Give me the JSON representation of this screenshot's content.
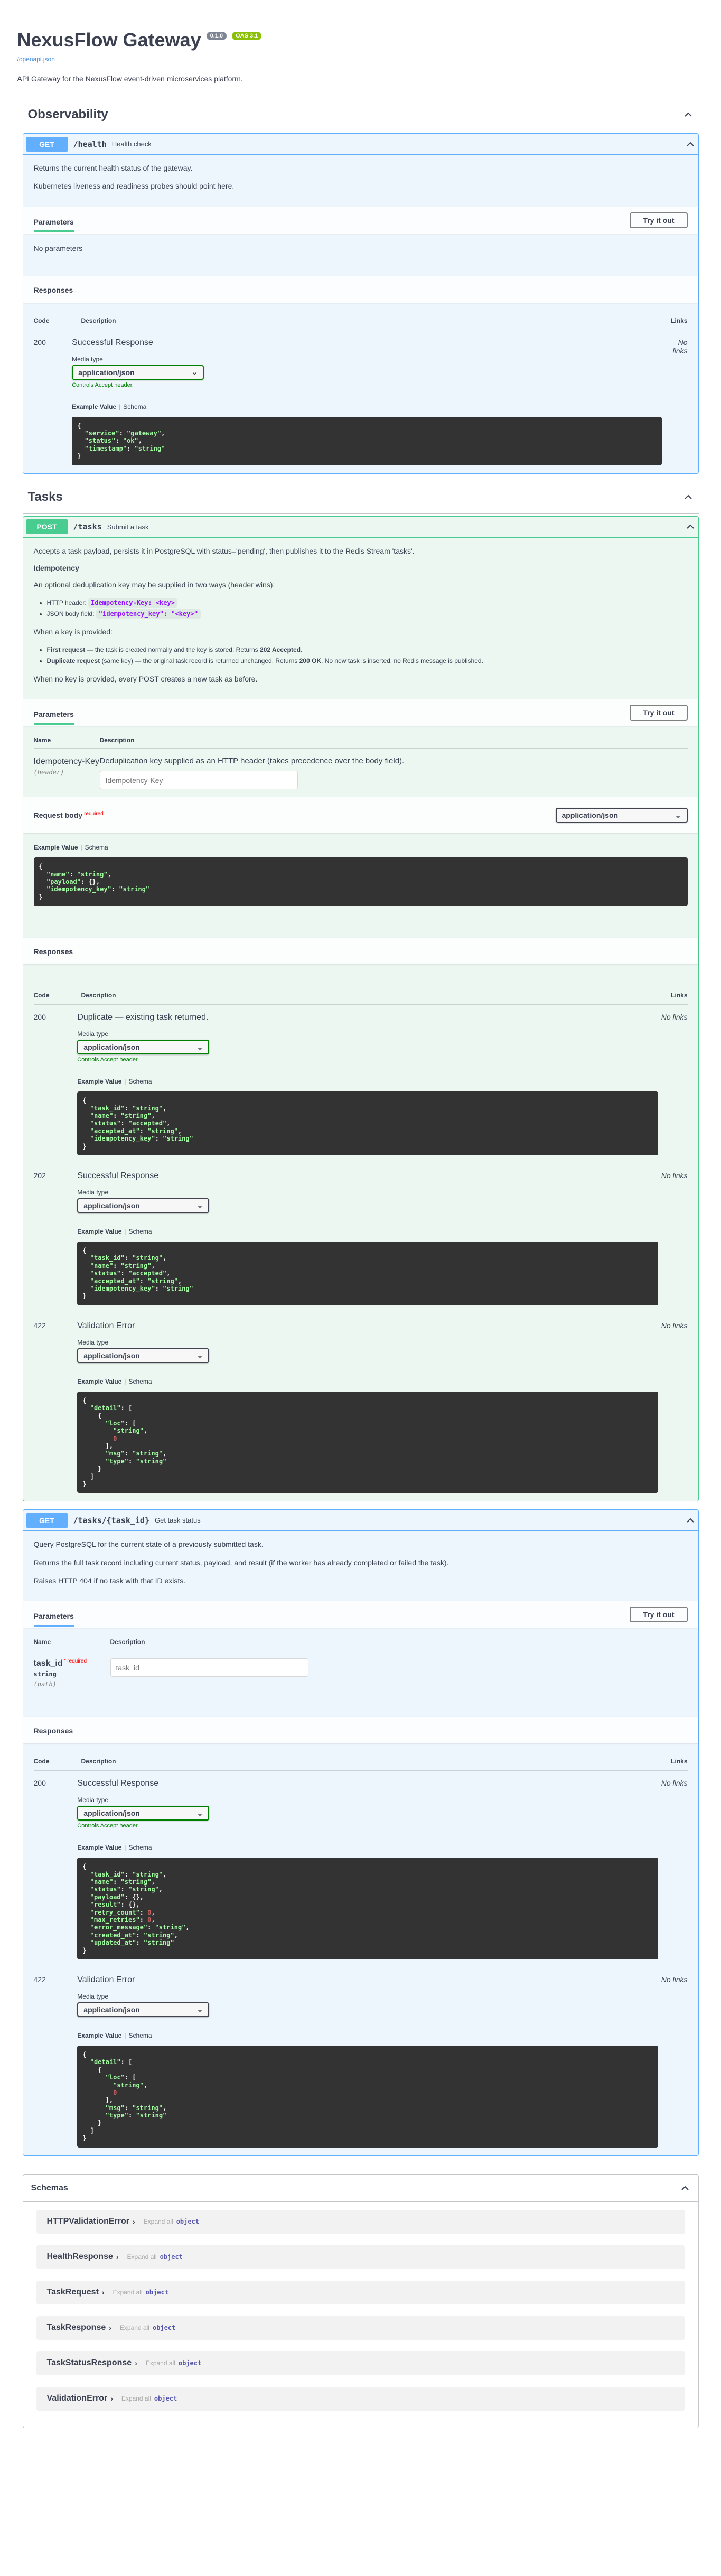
{
  "info": {
    "title": "NexusFlow Gateway",
    "version": "0.1.0",
    "oas": "OAS 3.1",
    "spec_link": "/openapi.json",
    "description": "API Gateway for the NexusFlow event-driven microservices platform."
  },
  "common": {
    "parameters": "Parameters",
    "try": "Try it out",
    "responses": "Responses",
    "code": "Code",
    "description": "Description",
    "links": "Links",
    "no_links": "No links",
    "media_type": "Media type",
    "controls_accept": "Controls Accept header.",
    "example_value": "Example Value",
    "schema": "Schema",
    "name": "Name",
    "required": "* required",
    "app_json": "application/json"
  },
  "observability": {
    "tag": "Observability",
    "method": "GET",
    "path": "/health",
    "summary": "Health check",
    "desc1": "Returns the current health status of the gateway.",
    "desc2": "Kubernetes liveness and readiness probes should point here.",
    "no_params": "No parameters",
    "code": "200",
    "resp_desc": "Successful Response"
  },
  "tasks": {
    "tag": "Tasks",
    "post": {
      "method": "POST",
      "path": "/tasks",
      "summary": "Submit a task",
      "desc1": "Accepts a task payload, persists it in PostgreSQL with status='pending', then publishes it to the Redis Stream 'tasks'.",
      "idem_h": "Idempotency",
      "idem_p": "An optional deduplication key may be supplied in two ways (header wins):",
      "li1_a": "HTTP header:",
      "li1_code": "Idempotency-Key: <key>",
      "li2_a": "JSON body field:",
      "li2_code": "\"idempotency_key\": \"<key>\"",
      "when_p": "When a key is provided:",
      "li3_b": "First request",
      "li3_t": " — the task is created normally and the key is stored. Returns ",
      "li3_s": "202 Accepted",
      "li3_e": ".",
      "li4_b": "Duplicate request",
      "li4_t": " (same key) — the original task record is returned unchanged. Returns ",
      "li4_s": "200 OK",
      "li4_e": ". No new task is inserted, no Redis message is published.",
      "no_key": "When no key is provided, every POST creates a new task as before.",
      "param_name": "Idempotency-Key",
      "param_in": "(header)",
      "param_desc": "Deduplication key supplied as an HTTP header (takes precedence over the body field).",
      "param_ph": "Idempotency-Key",
      "req_body": "Request body",
      "req_body_req": "required",
      "r200_code": "200",
      "r200_desc": "Duplicate — existing task returned.",
      "r202_code": "202",
      "r202_desc": "Successful Response",
      "r422_code": "422",
      "r422_desc": "Validation Error"
    },
    "get": {
      "method": "GET",
      "path": "/tasks/{task_id}",
      "summary": "Get task status",
      "desc1": "Query PostgreSQL for the current state of a previously submitted task.",
      "desc2": "Returns the full task record including current status, payload, and result (if the worker has already completed or failed the task).",
      "desc3": "Raises HTTP 404 if no task with that ID exists.",
      "param_name": "task_id",
      "param_req": "* required",
      "param_type": "string",
      "param_in": "(path)",
      "param_ph": "task_id",
      "r200_code": "200",
      "r200_desc": "Successful Response",
      "r422_code": "422",
      "r422_desc": "Validation Error"
    }
  },
  "schemas": {
    "title": "Schemas",
    "expand": "Expand all",
    "obj": "object",
    "items": [
      "HTTPValidationError",
      "HealthResponse",
      "TaskRequest",
      "TaskResponse",
      "TaskStatusResponse",
      "ValidationError"
    ]
  }
}
